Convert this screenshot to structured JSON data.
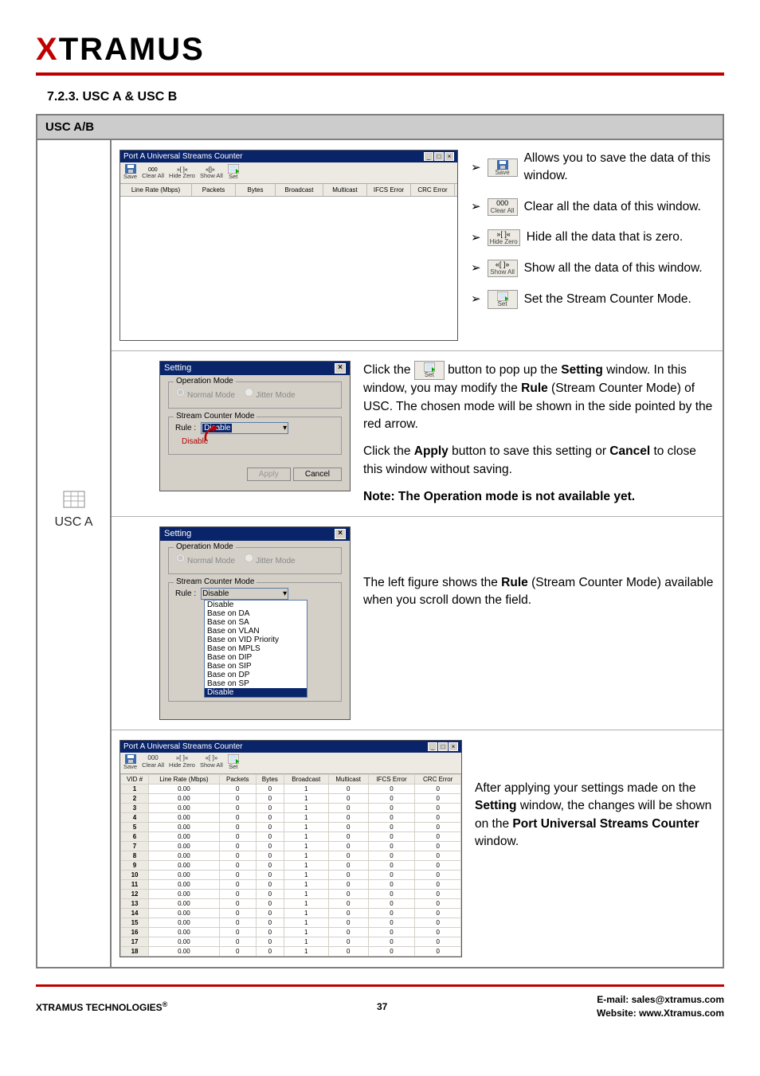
{
  "logo": {
    "pre": "X",
    "rest": "TRAMUS"
  },
  "section_heading": "7.2.3. USC A & USC B",
  "table_header": "USC A/B",
  "left_label": "USC A",
  "win1": {
    "title": "Port A Universal Streams Counter",
    "toolbar": [
      "Save",
      "Clear All",
      "Hide Zero",
      "Show All",
      "Set"
    ],
    "columns": [
      "Line Rate (Mbps)",
      "Packets",
      "Bytes",
      "Broadcast",
      "Multicast",
      "IFCS Error",
      "CRC Error"
    ]
  },
  "block1": {
    "saveLabel": "Save",
    "saveText": " Allows you to save the data of this window.",
    "clearLabel": "Clear All",
    "clearText": " Clear all the data of this window.",
    "hideLabel": "Hide Zero",
    "hideText": " Hide all the data that is zero.",
    "showLabel": "Show All",
    "showText": " Show all the data of this window.",
    "setLabel": "Set",
    "setText": " Set the Stream Counter Mode."
  },
  "block2": {
    "dlg_title": "Setting",
    "opmode_legend": "Operation Mode",
    "normal": "Normal Mode",
    "jitter": "Jitter Mode",
    "scm_legend": "Stream Counter Mode",
    "rule_label": "Rule :",
    "rule_value": "Disable",
    "rule_note": "Disable",
    "apply": "Apply",
    "cancel": "Cancel",
    "desc_1": "Click the ",
    "desc_2": " button to pop up the ",
    "desc_3": "Setting",
    "desc_4": " window. In this window, you may modify the ",
    "desc_5": "Rule",
    "desc_6": " (Stream Counter Mode) of USC. The chosen mode will be shown in the side pointed by the red arrow.",
    "desc_7": "Click the ",
    "desc_8": "Apply",
    "desc_9": " button to save this setting or ",
    "desc_10": "Cancel",
    "desc_11": " to close this window without saving.",
    "desc_note": "Note: The Operation mode is not available yet."
  },
  "block3": {
    "rule_options": [
      "Disable",
      "Base on DA",
      "Base on SA",
      "Base on VLAN",
      "Base on VID Priority",
      "Base on MPLS",
      "Base on DIP",
      "Base on SIP",
      "Base on DP",
      "Base on SP",
      "Disable"
    ],
    "desc_1": "The left figure shows the ",
    "desc_2": "Rule",
    "desc_3": " (Stream Counter Mode) available when you scroll down the field."
  },
  "block4": {
    "col_headers": [
      "VID #",
      "Line Rate (Mbps)",
      "Packets",
      "Bytes",
      "Broadcast",
      "Multicast",
      "IFCS Error",
      "CRC Error"
    ],
    "row_count": 18,
    "desc_1": "After applying your settings made on the ",
    "desc_2": "Setting",
    "desc_3": " window, the changes will be shown on the ",
    "desc_4": "Port Universal Streams Counter",
    "desc_5": " window."
  },
  "footer": {
    "left": "XTRAMUS TECHNOLOGIES",
    "page": "37",
    "email_label": "E-mail: ",
    "email": "sales@xtramus.com",
    "web_label": "Website:  ",
    "web": "www.Xtramus.com"
  }
}
